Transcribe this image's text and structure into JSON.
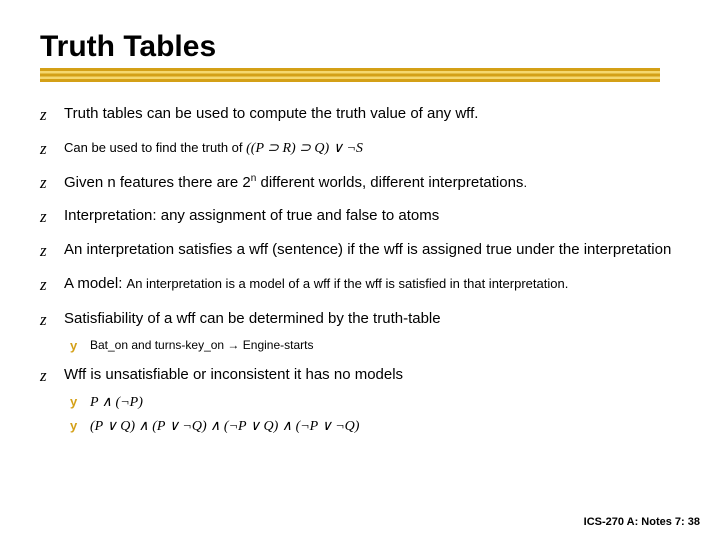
{
  "title": "Truth Tables",
  "bullets": [
    {
      "text": "Truth tables can be used to compute the truth value of any wff."
    },
    {
      "prefix": "Can be used to  find the truth of ",
      "formula": "((P ⊃ R) ⊃ Q) ∨ ¬S",
      "smallPrefix": true
    },
    {
      "html": "Given n features there are 2<sup>n</sup> different worlds, different interpretations",
      "suffixSmall": "."
    },
    {
      "text": "Interpretation: any assignment of true and false to atoms"
    },
    {
      "text": "An interpretation satisfies a wff (sentence)  if the wff is assigned true under the interpretation"
    },
    {
      "strong": "A model: ",
      "rest": "An interpretation is a model of a wff if the wff is satisfied in that interpretation.",
      "restSmall": true
    },
    {
      "text": "Satisfiability of a wff can be determined by the truth-table",
      "sub": [
        {
          "text": "Bat_on and turns-key_on → Engine-starts"
        }
      ]
    },
    {
      "text": "Wff is unsatisfiable or inconsistent it has no models",
      "sub": [
        {
          "formula": "P ∧ (¬P)"
        },
        {
          "formula": "(P ∨ Q) ∧ (P ∨ ¬Q) ∧ (¬P ∨ Q) ∧ (¬P ∨ ¬Q)"
        }
      ]
    }
  ],
  "footer": "ICS-270 A: Notes 7: 38"
}
